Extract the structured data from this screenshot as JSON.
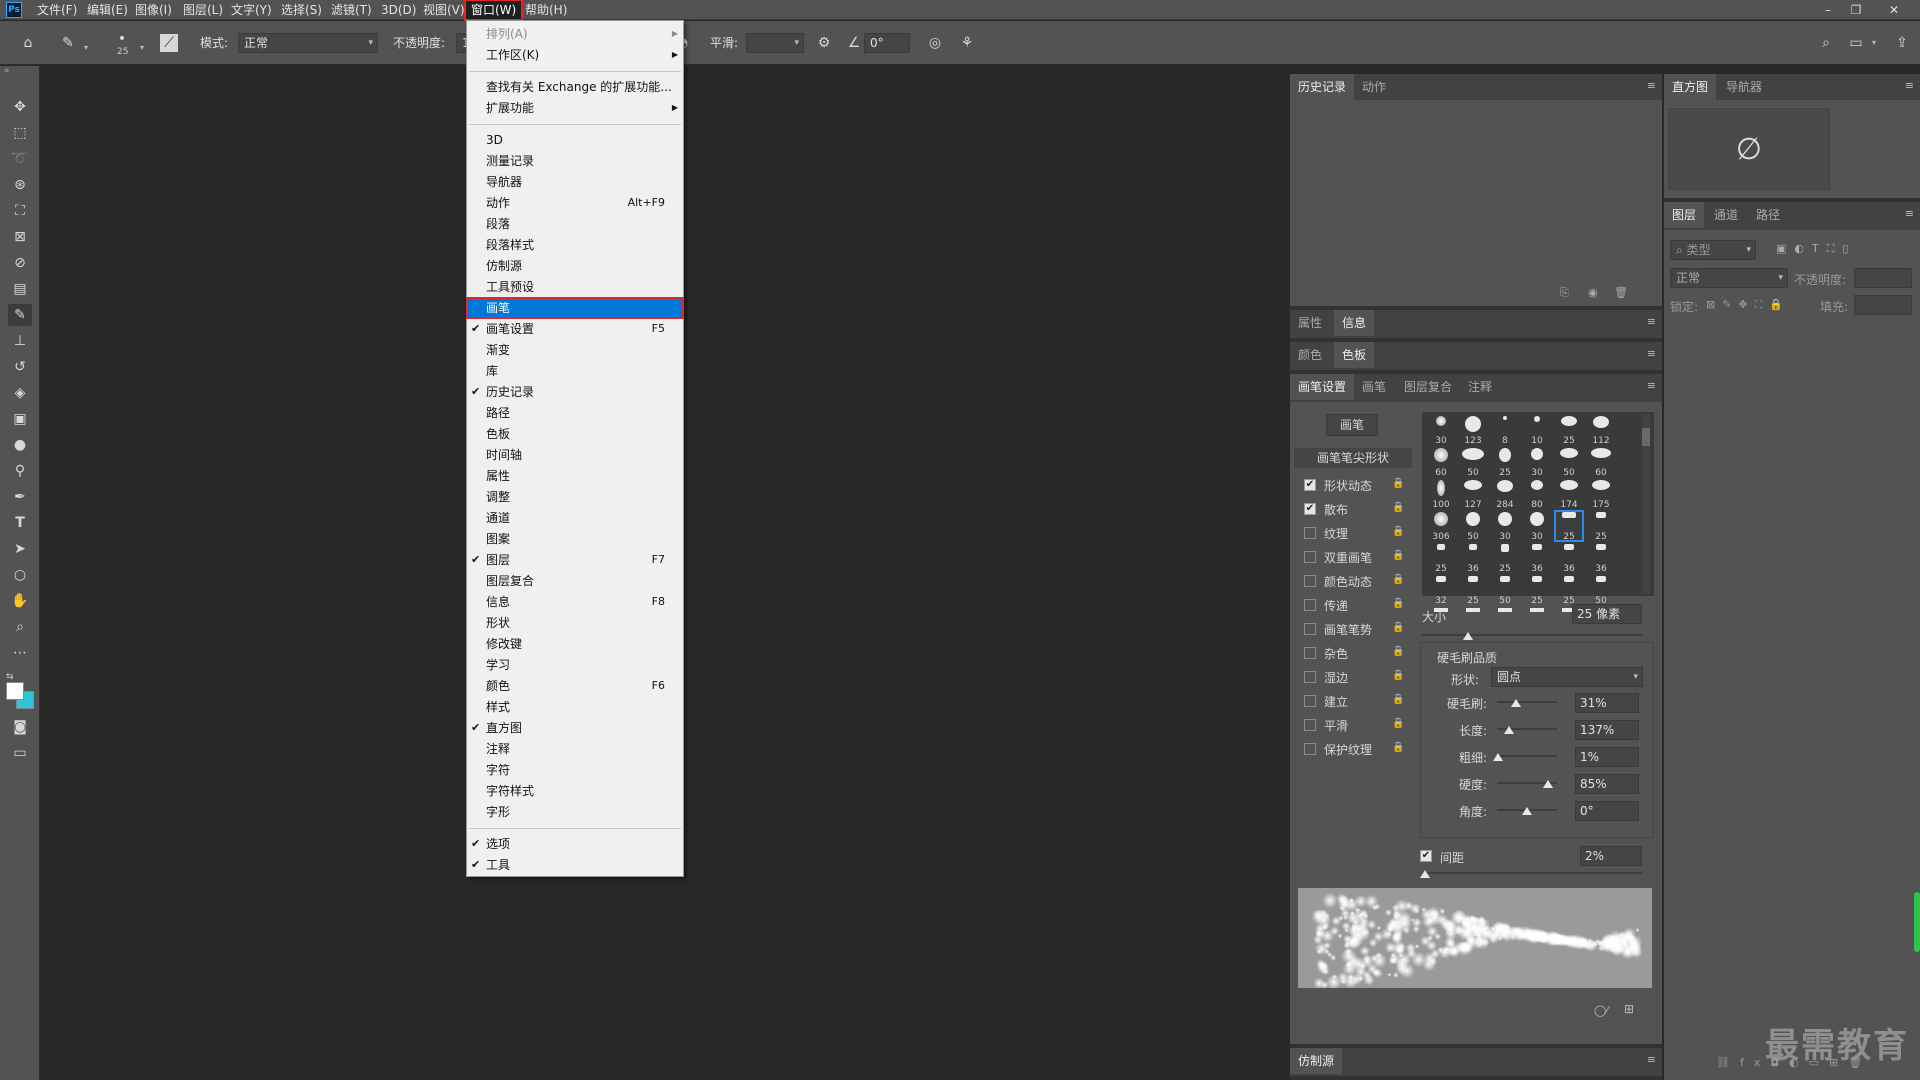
{
  "app": {
    "logo": "Ps"
  },
  "menubar": {
    "items": [
      "文件(F)",
      "编辑(E)",
      "图像(I)",
      "图层(L)",
      "文字(Y)",
      "选择(S)",
      "滤镜(T)",
      "3D(D)",
      "视图(V)",
      "窗口(W)",
      "帮助(H)"
    ],
    "active_index": 9
  },
  "options": {
    "brush_size": "25",
    "mode_label": "模式:",
    "mode_value": "正常",
    "opacity_label": "不透明度:",
    "opacity_value": "1",
    "smooth_label": "平滑:",
    "angle_value": "0°"
  },
  "window_menu": {
    "items": [
      {
        "label": "排列(A)",
        "sub": true,
        "disabled": true
      },
      {
        "label": "工作区(K)",
        "sub": true
      },
      {
        "sep": true
      },
      {
        "label": "查找有关 Exchange 的扩展功能..."
      },
      {
        "label": "扩展功能",
        "sub": true
      },
      {
        "sep": true
      },
      {
        "label": "3D"
      },
      {
        "label": "测量记录"
      },
      {
        "label": "导航器"
      },
      {
        "label": "动作",
        "shortcut": "Alt+F9"
      },
      {
        "label": "段落"
      },
      {
        "label": "段落样式"
      },
      {
        "label": "仿制源"
      },
      {
        "label": "工具预设"
      },
      {
        "label": "画笔",
        "highlight": true
      },
      {
        "label": "画笔设置",
        "shortcut": "F5",
        "checked": true
      },
      {
        "label": "渐变"
      },
      {
        "label": "库"
      },
      {
        "label": "历史记录",
        "checked": true
      },
      {
        "label": "路径"
      },
      {
        "label": "色板"
      },
      {
        "label": "时间轴"
      },
      {
        "label": "属性"
      },
      {
        "label": "调整"
      },
      {
        "label": "通道"
      },
      {
        "label": "图案"
      },
      {
        "label": "图层",
        "shortcut": "F7",
        "checked": true
      },
      {
        "label": "图层复合"
      },
      {
        "label": "信息",
        "shortcut": "F8"
      },
      {
        "label": "形状"
      },
      {
        "label": "修改键"
      },
      {
        "label": "学习"
      },
      {
        "label": "颜色",
        "shortcut": "F6"
      },
      {
        "label": "样式"
      },
      {
        "label": "直方图",
        "checked": true
      },
      {
        "label": "注释"
      },
      {
        "label": "字符"
      },
      {
        "label": "字符样式"
      },
      {
        "label": "字形"
      },
      {
        "sep": true
      },
      {
        "label": "选项",
        "checked": true
      },
      {
        "label": "工具",
        "checked": true
      }
    ]
  },
  "panels": {
    "history_tabs": [
      "历史记录",
      "动作"
    ],
    "props_tabs": [
      "属性",
      "信息"
    ],
    "color_tabs": [
      "颜色",
      "色板"
    ],
    "brush_tabs": [
      "画笔设置",
      "画笔",
      "图层复合",
      "注释"
    ],
    "brush_button": "画笔",
    "brush_tip_header": "画笔笔尖形状",
    "brush_options": [
      {
        "label": "形状动态",
        "checked": true
      },
      {
        "label": "散布",
        "checked": true
      },
      {
        "label": "纹理",
        "checked": false
      },
      {
        "label": "双重画笔",
        "checked": false
      },
      {
        "label": "颜色动态",
        "checked": false
      },
      {
        "label": "传递",
        "checked": false
      },
      {
        "label": "画笔笔势",
        "checked": false
      },
      {
        "label": "杂色",
        "checked": false
      },
      {
        "label": "湿边",
        "checked": false
      },
      {
        "label": "建立",
        "checked": false
      },
      {
        "label": "平滑",
        "checked": false
      },
      {
        "label": "保护纹理",
        "checked": false
      }
    ],
    "brush_sizes": [
      "30",
      "123",
      "8",
      "10",
      "25",
      "112",
      "60",
      "50",
      "25",
      "30",
      "50",
      "60",
      "100",
      "127",
      "284",
      "80",
      "174",
      "175",
      "306",
      "50",
      "30",
      "30",
      "25",
      "25",
      "25",
      "36",
      "25",
      "36",
      "36",
      "36",
      "32",
      "25",
      "50",
      "25",
      "25",
      "50"
    ],
    "size_label": "大小",
    "size_value": "25 像素",
    "bristle_header": "硬毛刷品质",
    "shape_label": "形状:",
    "shape_value": "圆点",
    "bristle": [
      {
        "label": "硬毛刷:",
        "value": "31%",
        "pos": 0.31
      },
      {
        "label": "长度:",
        "value": "137%",
        "pos": 0.2
      },
      {
        "label": "粗细:",
        "value": "1%",
        "pos": 0.01
      },
      {
        "label": "硬度:",
        "value": "85%",
        "pos": 0.85
      },
      {
        "label": "角度:",
        "value": "0°",
        "pos": 0.5
      }
    ],
    "spacing_label": "间距",
    "spacing_value": "2%",
    "spacing_checked": true,
    "clone_tab": "仿制源",
    "histogram_tabs": [
      "直方图",
      "导航器"
    ],
    "layers_tabs": [
      "图层",
      "通道",
      "路径"
    ],
    "layers_kind": "类型",
    "layers_mode": "正常",
    "layers_opacity_label": "不透明度:",
    "layers_lock_label": "锁定:",
    "layers_fill_label": "填充:"
  },
  "watermark": "最需教育"
}
